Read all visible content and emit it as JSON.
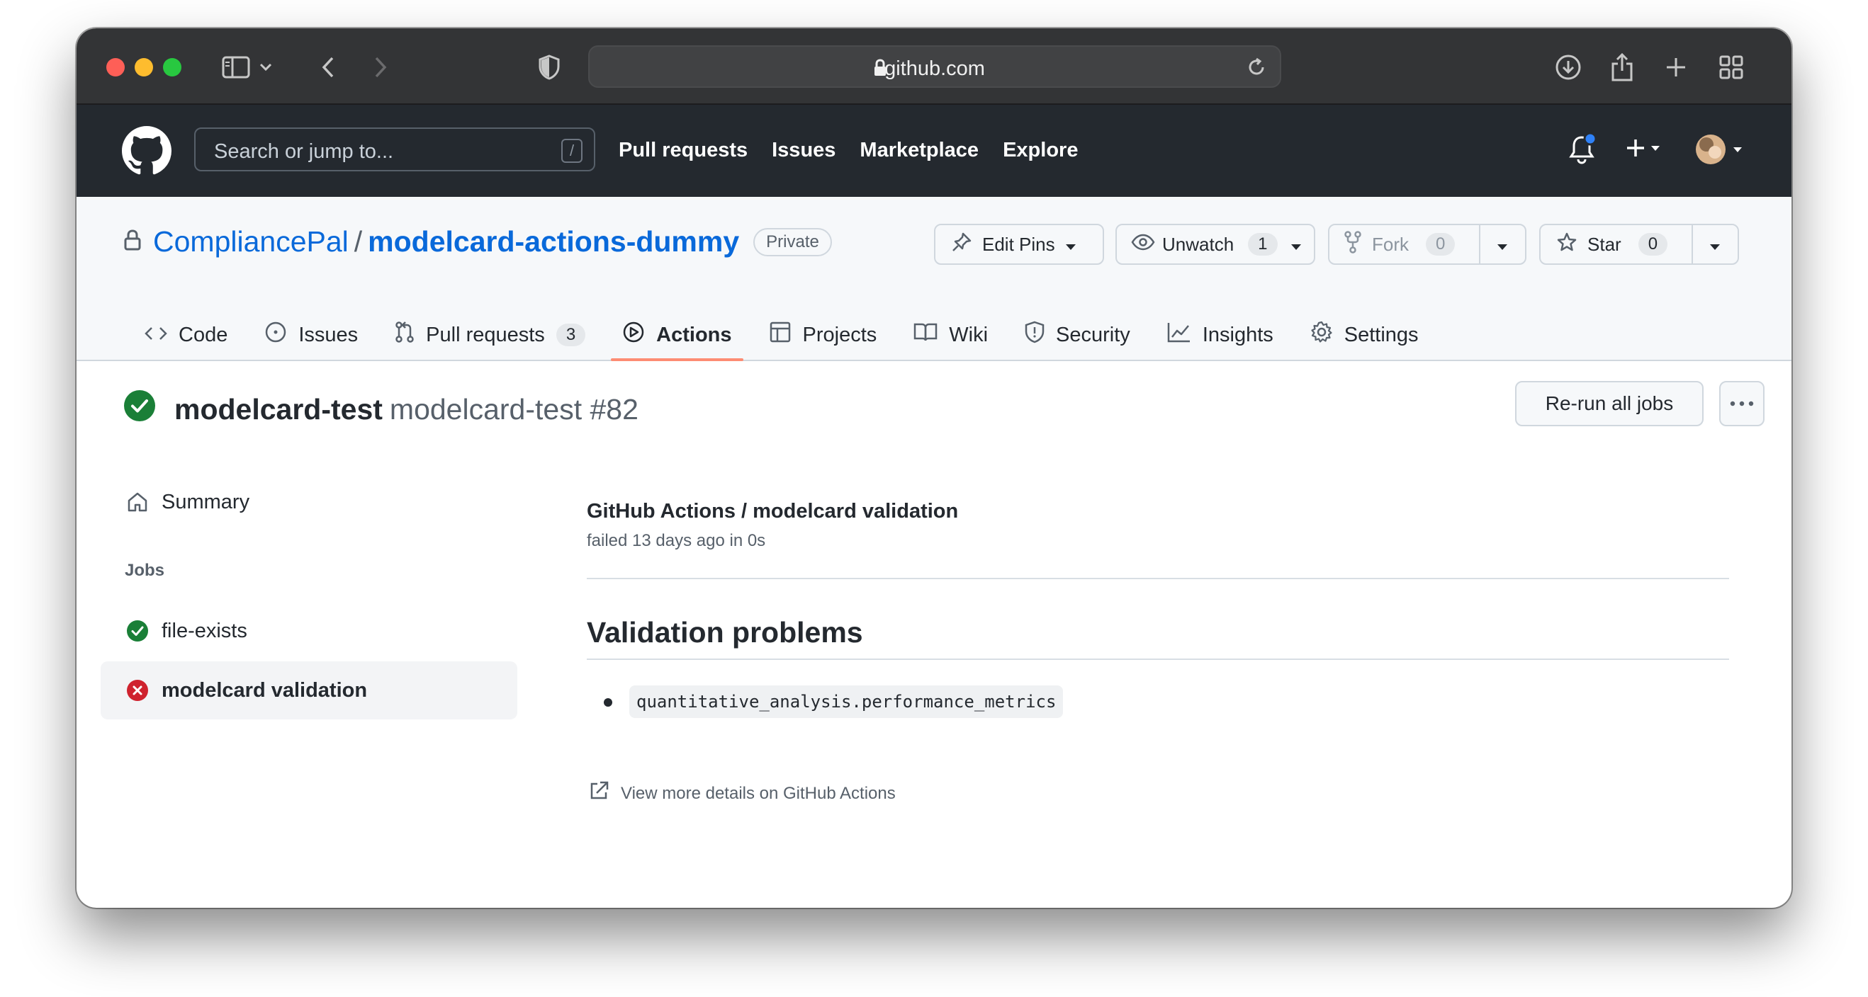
{
  "browser": {
    "url": "github.com"
  },
  "header": {
    "search_placeholder": "Search or jump to...",
    "search_shortcut": "/",
    "nav": [
      "Pull requests",
      "Issues",
      "Marketplace",
      "Explore"
    ]
  },
  "repo": {
    "owner": "CompliancePal",
    "separator": "/",
    "name": "modelcard-actions-dummy",
    "visibility": "Private",
    "edit_pins_label": "Edit Pins",
    "unwatch_label": "Unwatch",
    "watch_count": "1",
    "fork_label": "Fork",
    "fork_count": "0",
    "star_label": "Star",
    "star_count": "0"
  },
  "tabs": [
    {
      "label": "Code",
      "icon": "code-icon"
    },
    {
      "label": "Issues",
      "icon": "issue-icon"
    },
    {
      "label": "Pull requests",
      "icon": "pull-request-icon",
      "count": "3"
    },
    {
      "label": "Actions",
      "icon": "play-icon",
      "active": true
    },
    {
      "label": "Projects",
      "icon": "table-icon"
    },
    {
      "label": "Wiki",
      "icon": "book-icon"
    },
    {
      "label": "Security",
      "icon": "shield-icon"
    },
    {
      "label": "Insights",
      "icon": "graph-icon"
    },
    {
      "label": "Settings",
      "icon": "gear-icon"
    }
  ],
  "run": {
    "workflow_name": "modelcard-test",
    "run_label": "modelcard-test #82",
    "rerun_label": "Re-run all jobs"
  },
  "sidebar": {
    "summary_label": "Summary",
    "jobs_heading": "Jobs",
    "jobs": [
      {
        "label": "file-exists",
        "status": "success"
      },
      {
        "label": "modelcard validation",
        "status": "failure"
      }
    ]
  },
  "main": {
    "check_title": "GitHub Actions / modelcard validation",
    "check_subtitle": "failed 13 days ago in 0s",
    "section_title": "Validation problems",
    "problems": [
      "quantitative_analysis.performance_metrics"
    ],
    "details_link": "View more details on GitHub Actions"
  },
  "colors": {
    "success": "#1a7f37",
    "failure": "#cf222e",
    "link": "#0969da",
    "active_tab_underline": "#fd8c73",
    "header_bg": "#24292f"
  }
}
